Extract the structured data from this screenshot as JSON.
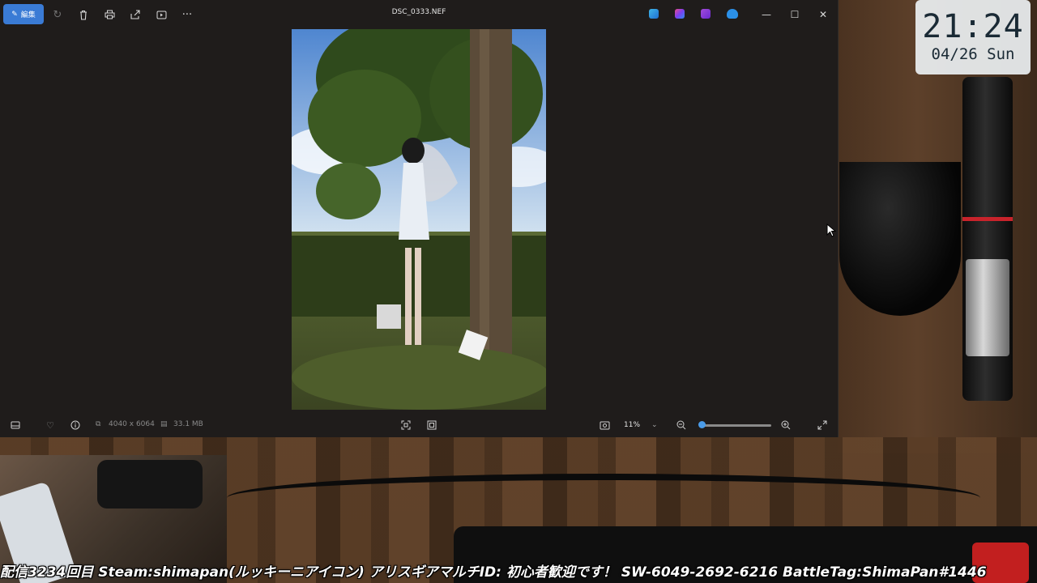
{
  "window": {
    "title": "DSC_0333.NEF",
    "edit_label": "編集"
  },
  "toolbar": {
    "icons": [
      "edit-icon",
      "rotate-icon",
      "trash-icon",
      "print-icon",
      "share-icon",
      "slideshow-icon",
      "more-icon"
    ],
    "more_label": "···"
  },
  "title_apps": [
    "clipchamp-icon",
    "copilot-icon",
    "clipchamp-video-icon",
    "onedrive-icon"
  ],
  "window_controls": {
    "minimize": "—",
    "maximize": "☐",
    "close": "✕"
  },
  "status": {
    "dimensions": "4040 x 6064",
    "file_size": "33.1 MB",
    "zoom": "11%",
    "zoom_fraction": 0.0
  },
  "clock": {
    "time": "21:24",
    "date": "04/26 Sun"
  },
  "ticker": "配信3234回目 Steam:shimapan(ルッキーニアイコン) アリスギアマルチID: 初心者歓迎です！ SW-6049-2692-6216 BattleTag:ShimaPan#1446",
  "colors": {
    "accent": "#3a7bd5",
    "window_bg": "#1f1c1b",
    "slider_knob": "#4a9be8"
  }
}
